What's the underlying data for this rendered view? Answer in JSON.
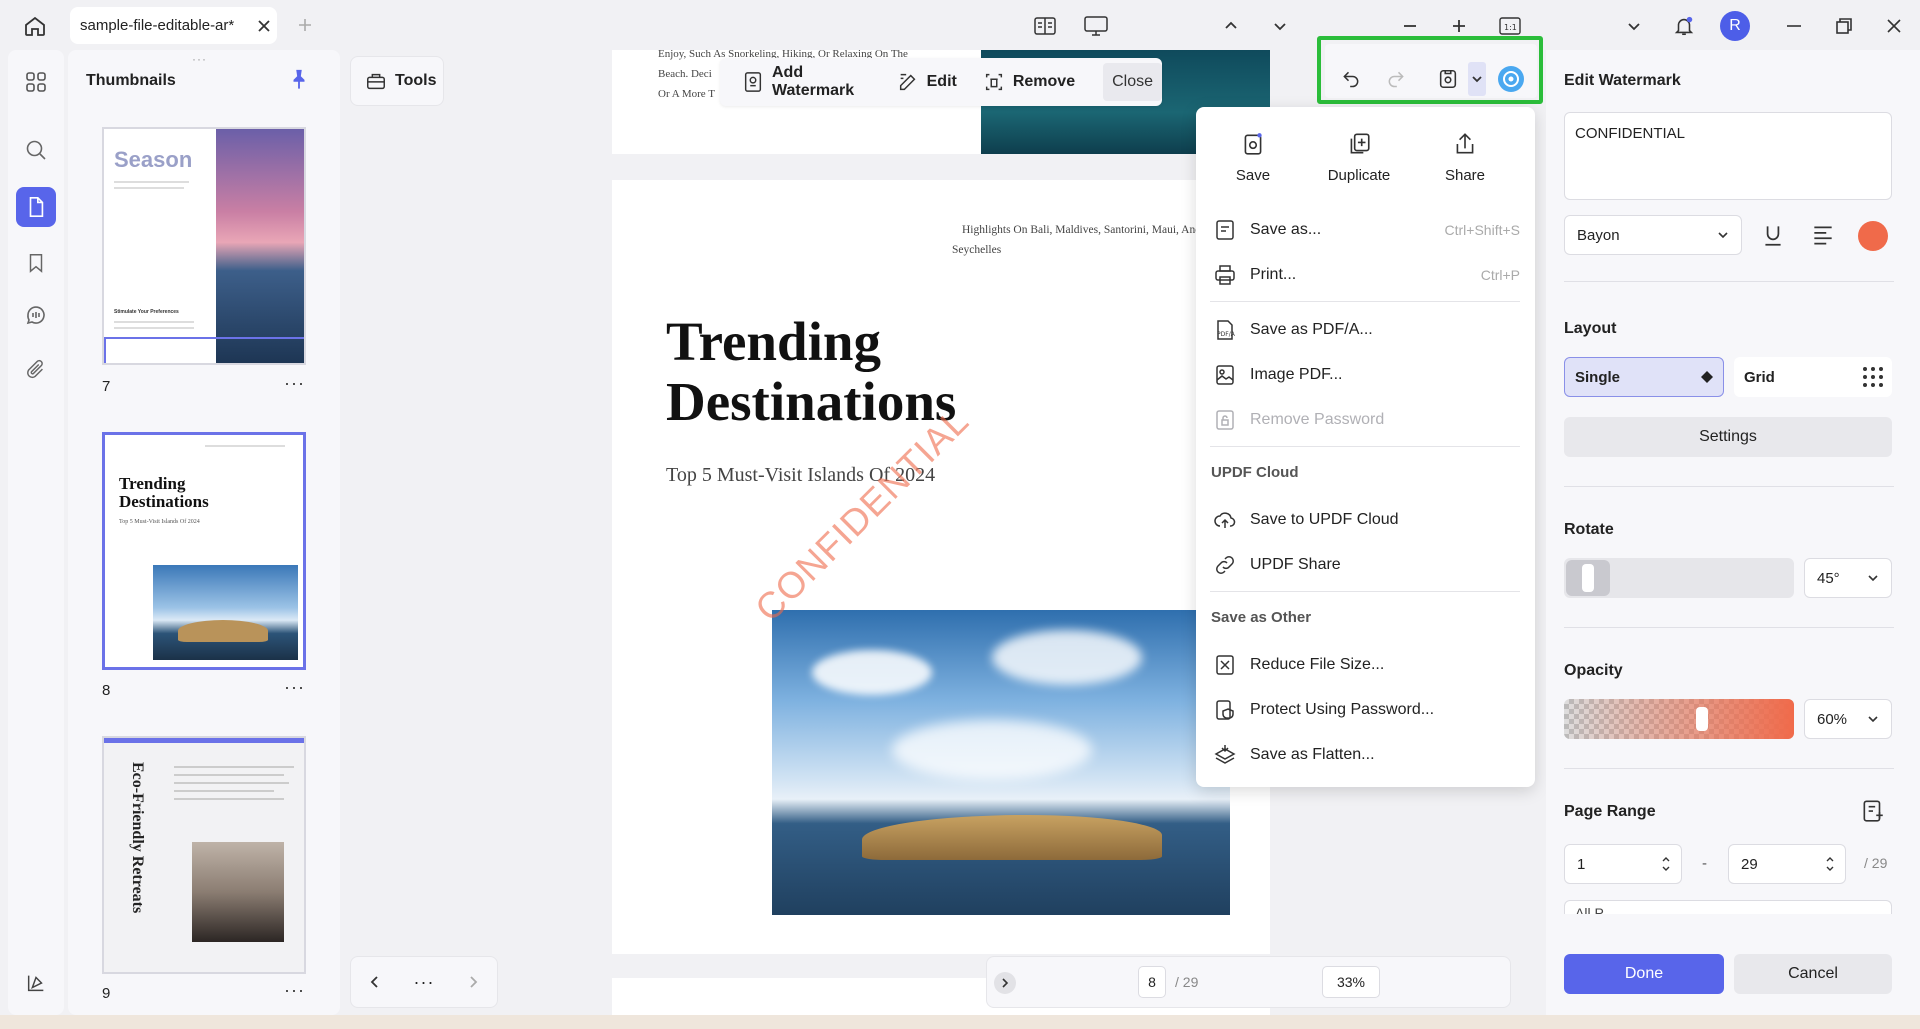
{
  "tab": {
    "title": "sample-file-editable-ar*"
  },
  "user": {
    "initial": "R"
  },
  "thumbnails": {
    "title": "Thumbnails",
    "pages": [
      {
        "number": "7",
        "title": "Season",
        "heading": "Stimulate Your Preferences"
      },
      {
        "number": "8",
        "title": "Trending Destinations",
        "subtitle": "Top 5 Must-Visit Islands Of 2024"
      },
      {
        "number": "9",
        "title": "Eco-Friendly Retreats"
      }
    ],
    "more": "···"
  },
  "tools": {
    "label": "Tools"
  },
  "watermark_toolbar": {
    "add": "Add Watermark",
    "edit": "Edit",
    "remove": "Remove",
    "close": "Close"
  },
  "document": {
    "top_text": [
      "Enjoy, Such As Snorkeling, Hiking, Or Relaxing On The",
      "Beach. Deci",
      "Or A More T"
    ],
    "header_text": [
      "Highlights On Bali, Maldives, Santorini, Maui, And",
      "Seychelles"
    ],
    "title_line1": "Trending",
    "title_line2": "Destinations",
    "subtitle": "Top 5 Must-Visit Islands Of 2024",
    "watermark": "CONFIDENTIAL"
  },
  "save_menu": {
    "top_actions": [
      {
        "label": "Save",
        "icon": "save-icon"
      },
      {
        "label": "Duplicate",
        "icon": "duplicate-icon"
      },
      {
        "label": "Share",
        "icon": "share-icon"
      }
    ],
    "items": [
      {
        "label": "Save as...",
        "shortcut": "Ctrl+Shift+S"
      },
      {
        "label": "Print...",
        "shortcut": "Ctrl+P"
      },
      {
        "label": "Save as PDF/A..."
      },
      {
        "label": "Image PDF..."
      },
      {
        "label": "Remove Password"
      },
      {
        "label": "Save to UPDF Cloud"
      },
      {
        "label": "UPDF Share"
      },
      {
        "label": "Reduce File Size..."
      },
      {
        "label": "Protect Using Password..."
      },
      {
        "label": "Save as Flatten..."
      }
    ],
    "section_cloud": "UPDF Cloud",
    "section_other": "Save as Other"
  },
  "right_panel": {
    "title": "Edit Watermark",
    "text": "CONFIDENTIAL",
    "font": "Bayon",
    "color": "#f06a4a",
    "layout": {
      "title": "Layout",
      "single": "Single",
      "grid": "Grid",
      "settings": "Settings"
    },
    "rotate": {
      "title": "Rotate",
      "value": "45°"
    },
    "opacity": {
      "title": "Opacity",
      "value": "60%",
      "level": 0.6
    },
    "page_range": {
      "title": "Page Range",
      "from": "1",
      "dash": "-",
      "to": "29",
      "total": "/ 29",
      "subset": "All P..."
    },
    "done": "Done",
    "cancel": "Cancel"
  },
  "bottom": {
    "page": "8",
    "total": "/ 29",
    "zoom": "33%",
    "more": "···"
  },
  "colors": {
    "accent": "#5865ea",
    "highlight": "#2bbd3a",
    "watermark": "#f06a4a"
  }
}
